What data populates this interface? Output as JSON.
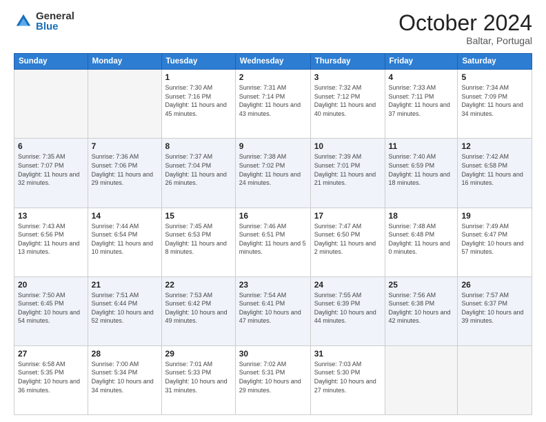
{
  "logo": {
    "general": "General",
    "blue": "Blue"
  },
  "header": {
    "month": "October 2024",
    "location": "Baltar, Portugal"
  },
  "days_of_week": [
    "Sunday",
    "Monday",
    "Tuesday",
    "Wednesday",
    "Thursday",
    "Friday",
    "Saturday"
  ],
  "weeks": [
    [
      {
        "day": "",
        "info": ""
      },
      {
        "day": "",
        "info": ""
      },
      {
        "day": "1",
        "info": "Sunrise: 7:30 AM\nSunset: 7:16 PM\nDaylight: 11 hours and 45 minutes."
      },
      {
        "day": "2",
        "info": "Sunrise: 7:31 AM\nSunset: 7:14 PM\nDaylight: 11 hours and 43 minutes."
      },
      {
        "day": "3",
        "info": "Sunrise: 7:32 AM\nSunset: 7:12 PM\nDaylight: 11 hours and 40 minutes."
      },
      {
        "day": "4",
        "info": "Sunrise: 7:33 AM\nSunset: 7:11 PM\nDaylight: 11 hours and 37 minutes."
      },
      {
        "day": "5",
        "info": "Sunrise: 7:34 AM\nSunset: 7:09 PM\nDaylight: 11 hours and 34 minutes."
      }
    ],
    [
      {
        "day": "6",
        "info": "Sunrise: 7:35 AM\nSunset: 7:07 PM\nDaylight: 11 hours and 32 minutes."
      },
      {
        "day": "7",
        "info": "Sunrise: 7:36 AM\nSunset: 7:06 PM\nDaylight: 11 hours and 29 minutes."
      },
      {
        "day": "8",
        "info": "Sunrise: 7:37 AM\nSunset: 7:04 PM\nDaylight: 11 hours and 26 minutes."
      },
      {
        "day": "9",
        "info": "Sunrise: 7:38 AM\nSunset: 7:02 PM\nDaylight: 11 hours and 24 minutes."
      },
      {
        "day": "10",
        "info": "Sunrise: 7:39 AM\nSunset: 7:01 PM\nDaylight: 11 hours and 21 minutes."
      },
      {
        "day": "11",
        "info": "Sunrise: 7:40 AM\nSunset: 6:59 PM\nDaylight: 11 hours and 18 minutes."
      },
      {
        "day": "12",
        "info": "Sunrise: 7:42 AM\nSunset: 6:58 PM\nDaylight: 11 hours and 16 minutes."
      }
    ],
    [
      {
        "day": "13",
        "info": "Sunrise: 7:43 AM\nSunset: 6:56 PM\nDaylight: 11 hours and 13 minutes."
      },
      {
        "day": "14",
        "info": "Sunrise: 7:44 AM\nSunset: 6:54 PM\nDaylight: 11 hours and 10 minutes."
      },
      {
        "day": "15",
        "info": "Sunrise: 7:45 AM\nSunset: 6:53 PM\nDaylight: 11 hours and 8 minutes."
      },
      {
        "day": "16",
        "info": "Sunrise: 7:46 AM\nSunset: 6:51 PM\nDaylight: 11 hours and 5 minutes."
      },
      {
        "day": "17",
        "info": "Sunrise: 7:47 AM\nSunset: 6:50 PM\nDaylight: 11 hours and 2 minutes."
      },
      {
        "day": "18",
        "info": "Sunrise: 7:48 AM\nSunset: 6:48 PM\nDaylight: 11 hours and 0 minutes."
      },
      {
        "day": "19",
        "info": "Sunrise: 7:49 AM\nSunset: 6:47 PM\nDaylight: 10 hours and 57 minutes."
      }
    ],
    [
      {
        "day": "20",
        "info": "Sunrise: 7:50 AM\nSunset: 6:45 PM\nDaylight: 10 hours and 54 minutes."
      },
      {
        "day": "21",
        "info": "Sunrise: 7:51 AM\nSunset: 6:44 PM\nDaylight: 10 hours and 52 minutes."
      },
      {
        "day": "22",
        "info": "Sunrise: 7:53 AM\nSunset: 6:42 PM\nDaylight: 10 hours and 49 minutes."
      },
      {
        "day": "23",
        "info": "Sunrise: 7:54 AM\nSunset: 6:41 PM\nDaylight: 10 hours and 47 minutes."
      },
      {
        "day": "24",
        "info": "Sunrise: 7:55 AM\nSunset: 6:39 PM\nDaylight: 10 hours and 44 minutes."
      },
      {
        "day": "25",
        "info": "Sunrise: 7:56 AM\nSunset: 6:38 PM\nDaylight: 10 hours and 42 minutes."
      },
      {
        "day": "26",
        "info": "Sunrise: 7:57 AM\nSunset: 6:37 PM\nDaylight: 10 hours and 39 minutes."
      }
    ],
    [
      {
        "day": "27",
        "info": "Sunrise: 6:58 AM\nSunset: 5:35 PM\nDaylight: 10 hours and 36 minutes."
      },
      {
        "day": "28",
        "info": "Sunrise: 7:00 AM\nSunset: 5:34 PM\nDaylight: 10 hours and 34 minutes."
      },
      {
        "day": "29",
        "info": "Sunrise: 7:01 AM\nSunset: 5:33 PM\nDaylight: 10 hours and 31 minutes."
      },
      {
        "day": "30",
        "info": "Sunrise: 7:02 AM\nSunset: 5:31 PM\nDaylight: 10 hours and 29 minutes."
      },
      {
        "day": "31",
        "info": "Sunrise: 7:03 AM\nSunset: 5:30 PM\nDaylight: 10 hours and 27 minutes."
      },
      {
        "day": "",
        "info": ""
      },
      {
        "day": "",
        "info": ""
      }
    ]
  ]
}
